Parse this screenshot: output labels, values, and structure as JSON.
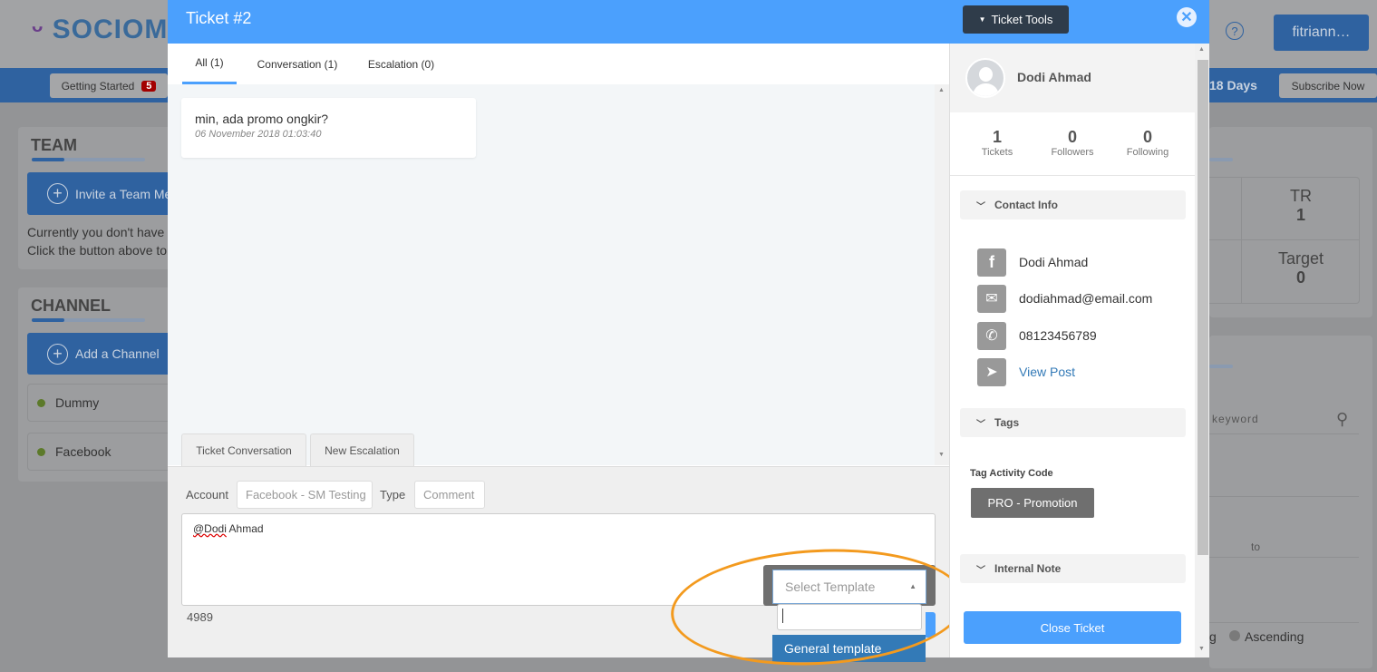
{
  "background": {
    "logo": "SOCIOM",
    "getting_started": "Getting Started",
    "getting_started_badge": "5",
    "trial_days": "18 Days",
    "subscribe": "Subscribe Now",
    "user": "fitriann…",
    "help_icon": "question-circle-icon",
    "team": {
      "title": "TEAM",
      "invite": "Invite a Team Me",
      "empty_line1": "Currently you don't have",
      "empty_line2": "Click the button above to"
    },
    "channel": {
      "title": "CHANNEL",
      "add": "Add a Channel",
      "items": [
        "Dummy",
        "Facebook"
      ]
    },
    "stats": [
      {
        "label": "TR",
        "value": "1"
      },
      {
        "label": "Target",
        "value": "0"
      }
    ],
    "search_placeholder": "keyword",
    "date_to": "to",
    "sort_partial": "g",
    "sort_ascending": "Ascending"
  },
  "modal": {
    "title": "Ticket #2",
    "ticket_tools": "Ticket Tools",
    "tabs": [
      {
        "label": "All (1)",
        "active": true
      },
      {
        "label": "Conversation (1)"
      },
      {
        "label": "Escalation (0)"
      }
    ],
    "message": {
      "text": "min, ada promo ongkir?",
      "date": "06 November 2018 01:03:40"
    },
    "compose_tabs": [
      "Ticket Conversation",
      "New Escalation"
    ],
    "account_label": "Account",
    "account_value": "Facebook - SM Testing",
    "type_label": "Type",
    "type_value": "Comment",
    "reply_mention": "@Dodi",
    "reply_rest": " Ahmad",
    "char_count": "4989",
    "template": {
      "placeholder": "Select Template",
      "search_value": "",
      "options": [
        "General template"
      ]
    },
    "highlight_color": "#f39a1e"
  },
  "contact": {
    "name": "Dodi Ahmad",
    "stats": [
      {
        "value": "1",
        "label": "Tickets"
      },
      {
        "value": "0",
        "label": "Followers"
      },
      {
        "value": "0",
        "label": "Following"
      }
    ],
    "contact_info_title": "Contact Info",
    "facebook_name": "Dodi Ahmad",
    "email": "dodiahmad@email.com",
    "phone": "08123456789",
    "view_post": "View Post",
    "tags_title": "Tags",
    "tag_activity_label": "Tag Activity Code",
    "tag": "PRO - Promotion",
    "internal_note_title": "Internal Note",
    "close_ticket": "Close Ticket"
  },
  "colors": {
    "primary": "#4ba0fd",
    "dark_button": "#2f3c4a",
    "selected_option": "#337ab7"
  }
}
